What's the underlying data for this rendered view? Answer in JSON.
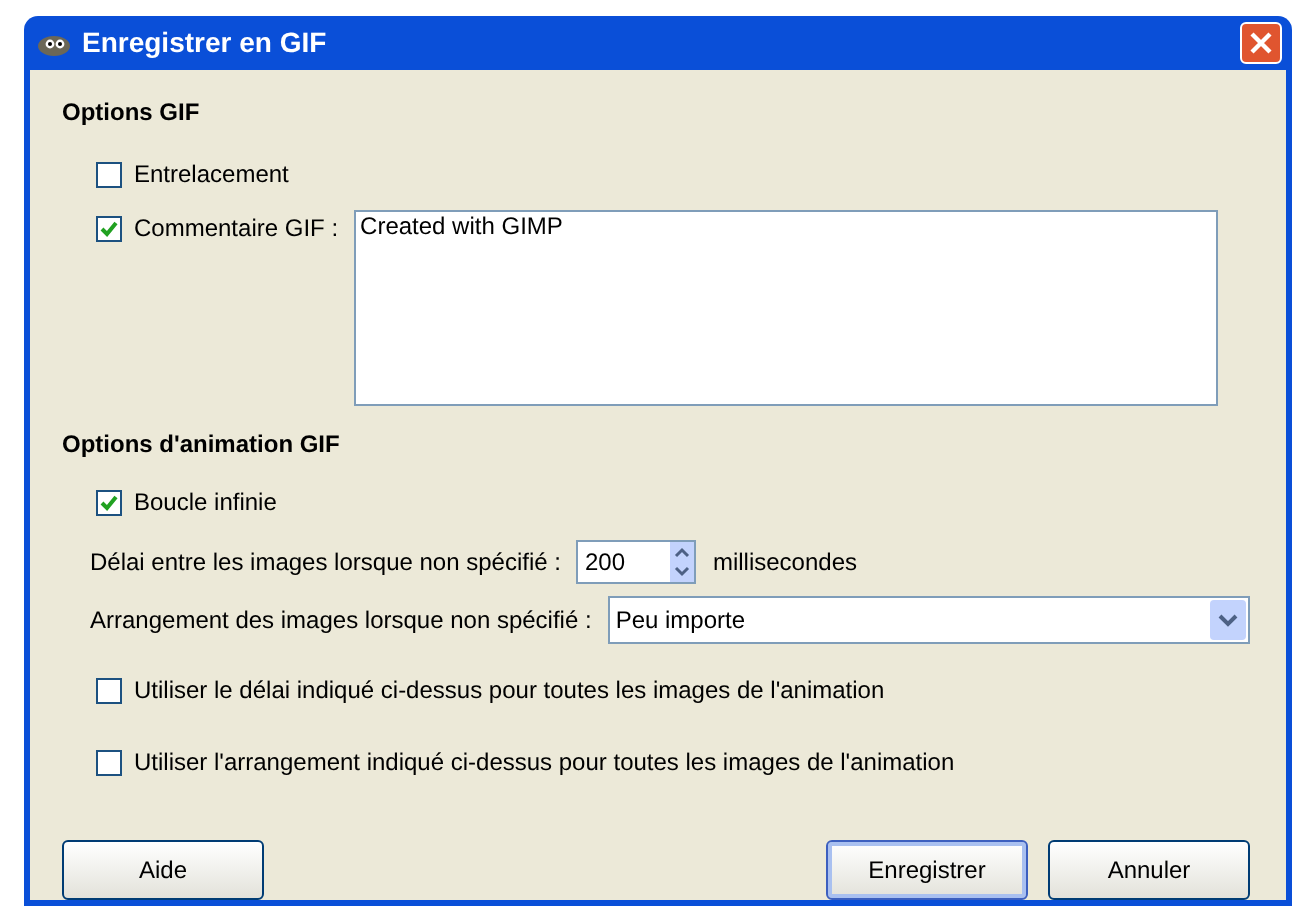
{
  "window": {
    "title": "Enregistrer en GIF"
  },
  "gif_options": {
    "heading": "Options GIF",
    "interlace": {
      "label": "Entrelacement",
      "checked": false
    },
    "comment": {
      "label": "Commentaire GIF :",
      "checked": true,
      "value": "Created with GIMP"
    }
  },
  "animation_options": {
    "heading": "Options d'animation GIF",
    "loop": {
      "label": "Boucle infinie",
      "checked": true
    },
    "delay": {
      "label": "Délai entre les images lorsque non spécifié :",
      "value": "200",
      "unit": "millisecondes"
    },
    "disposal": {
      "label": "Arrangement des images lorsque non spécifié :",
      "value": "Peu importe"
    },
    "use_delay": {
      "label": "Utiliser le délai indiqué ci-dessus pour toutes les images de l'animation",
      "checked": false
    },
    "use_disposal": {
      "label": "Utiliser l'arrangement indiqué ci-dessus pour toutes les images de l'animation",
      "checked": false
    }
  },
  "buttons": [
    {
      "label": "Aide",
      "selected": false
    },
    {
      "label": "Enregistrer",
      "selected": true
    },
    {
      "label": "Annuler",
      "selected": false
    }
  ]
}
